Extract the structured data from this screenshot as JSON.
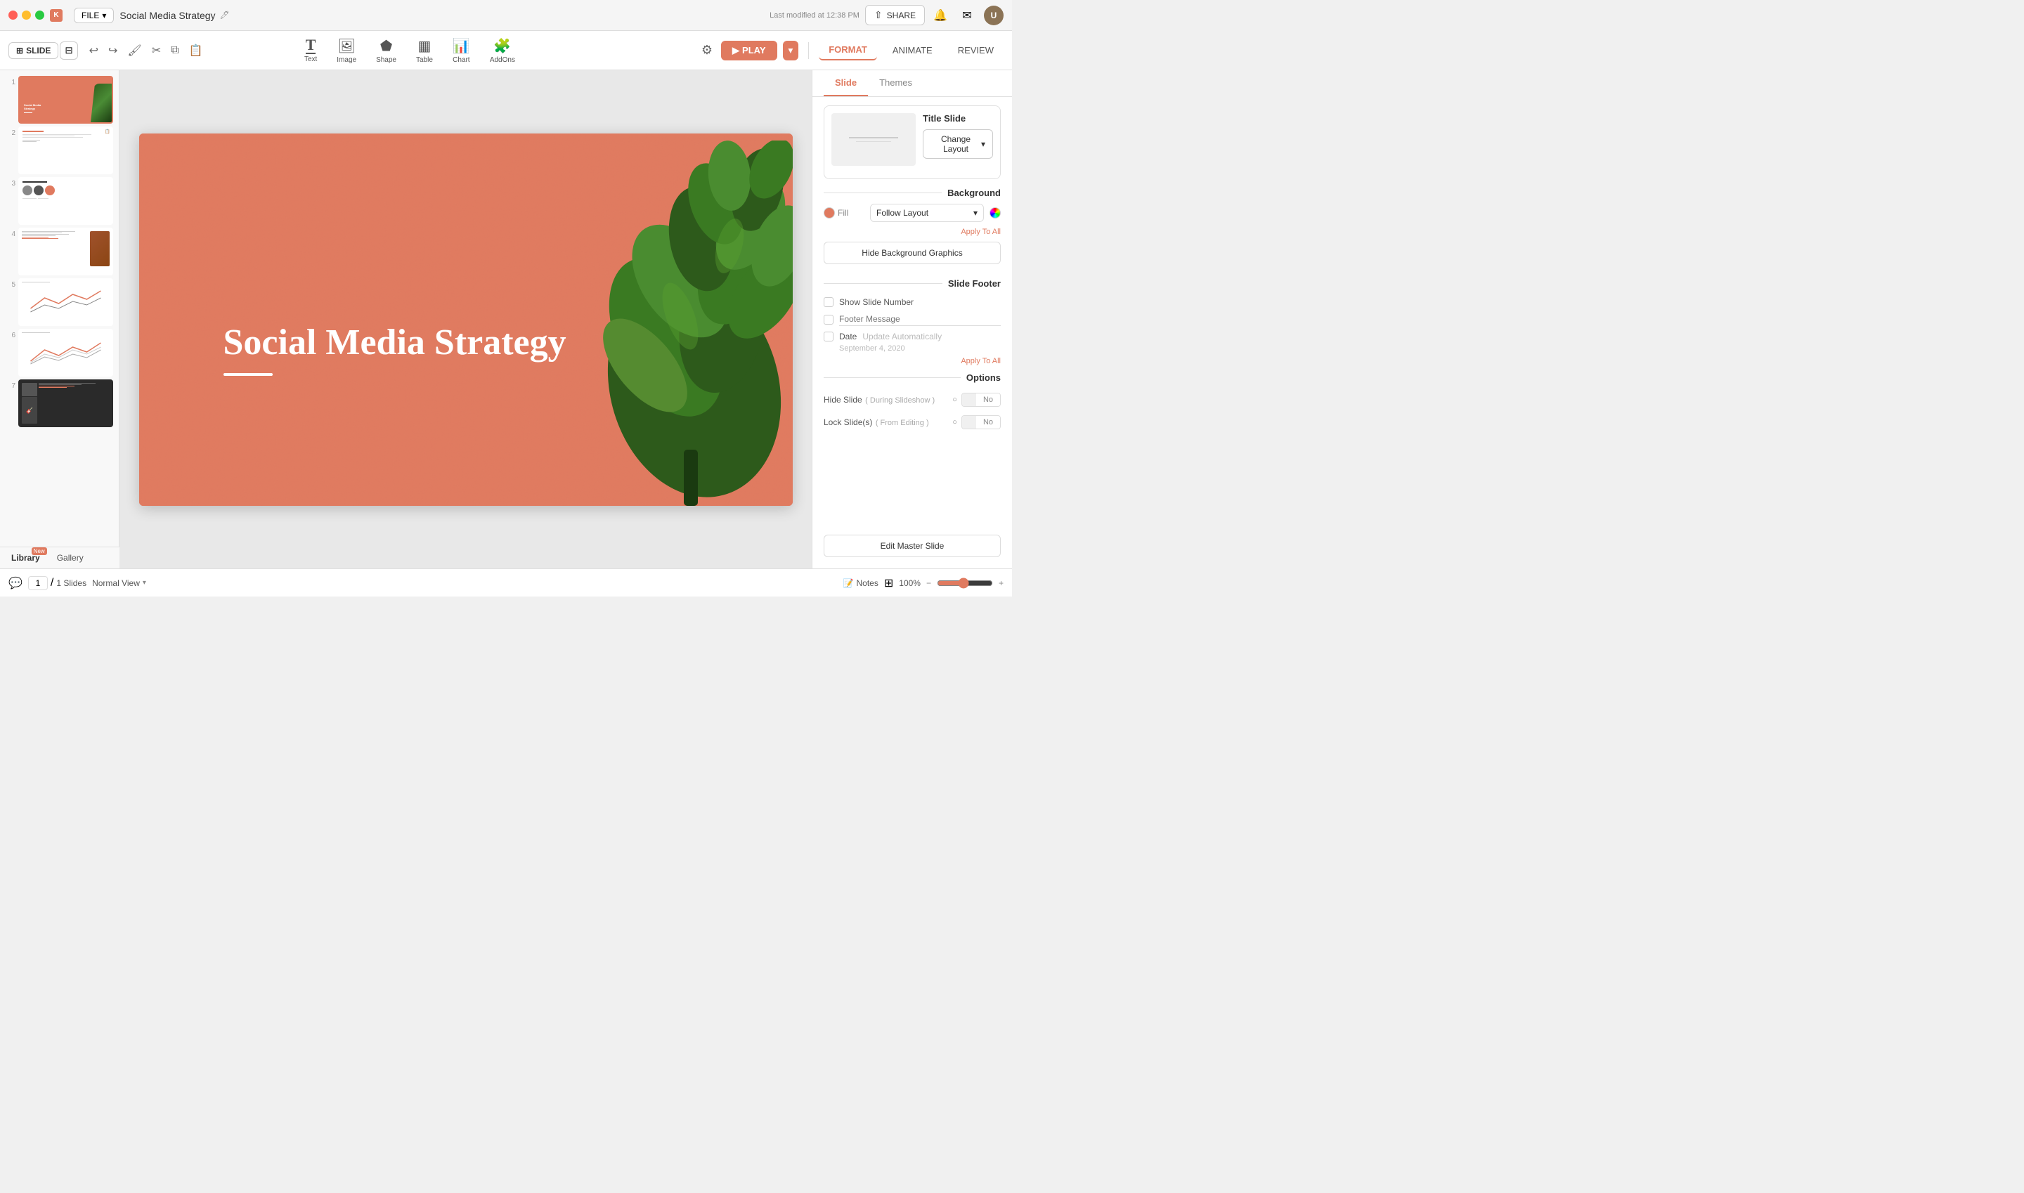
{
  "app": {
    "traffic_lights": [
      "red",
      "yellow",
      "green"
    ],
    "file_label": "FILE",
    "doc_title": "Social Media Strategy",
    "last_modified": "Last modified at 12:38 PM",
    "share_label": "SHARE"
  },
  "toolbar": {
    "slide_label": "SLIDE",
    "undo_icon": "↩",
    "redo_icon": "↪",
    "play_label": "PLAY",
    "format_label": "FORMAT",
    "animate_label": "ANIMATE",
    "review_label": "REVIEW"
  },
  "tools": [
    {
      "icon": "T",
      "label": "Text"
    },
    {
      "icon": "🖼",
      "label": "Image"
    },
    {
      "icon": "⬟",
      "label": "Shape"
    },
    {
      "icon": "▦",
      "label": "Table"
    },
    {
      "icon": "📊",
      "label": "Chart"
    },
    {
      "icon": "🧩",
      "label": "AddOns"
    }
  ],
  "slide": {
    "title": "Social Media Strategy",
    "current": "1",
    "total": "1 Slides"
  },
  "format_panel": {
    "slide_tab": "Slide",
    "themes_tab": "Themes",
    "layout_title": "Title Slide",
    "change_layout_label": "Change Layout",
    "change_layout_chevron": "▾",
    "background_section": "Background",
    "fill_label": "Fill",
    "follow_layout_label": "Follow Layout",
    "apply_to_all_label": "Apply To All",
    "hide_bg_label": "Hide Background Graphics",
    "footer_section": "Slide Footer",
    "show_slide_number_label": "Show Slide Number",
    "footer_message_label": "Footer Message",
    "footer_message_placeholder": "Footer Message",
    "date_label": "Date",
    "update_auto_label": "Update Automatically",
    "date_value": "September 4, 2020",
    "apply_to_all_footer": "Apply To All",
    "options_section": "Options",
    "hide_slide_label": "Hide Slide",
    "hide_slide_sub": "( During Slideshow )",
    "lock_slide_label": "Lock Slide(s)",
    "lock_slide_sub": "( From Editing )",
    "no_label_1": "No",
    "no_label_2": "No",
    "edit_master_label": "Edit Master Slide"
  },
  "status_bar": {
    "page_current": "1",
    "page_separator": "/",
    "page_total": "1 Slides",
    "view_mode": "Normal View",
    "notes_label": "Notes",
    "zoom_percent": "100%",
    "library_label": "Library",
    "gallery_label": "Gallery",
    "new_badge": "New"
  }
}
